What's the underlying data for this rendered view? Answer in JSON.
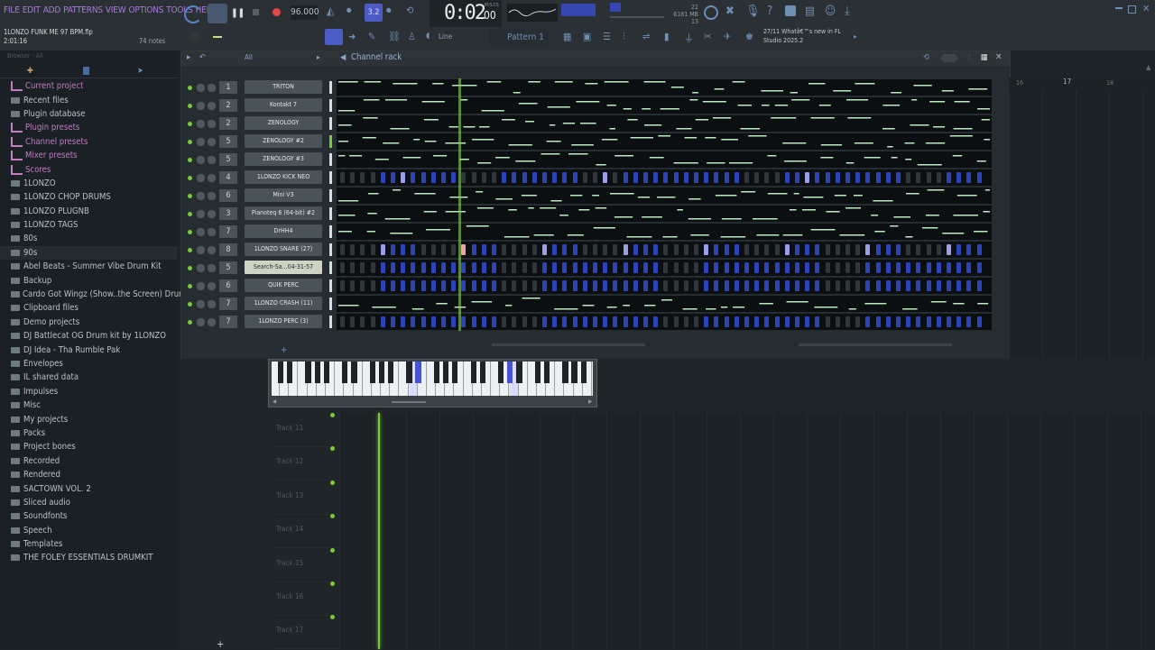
{
  "menu": [
    "FILE",
    "EDIT",
    "ADD",
    "PATTERNS",
    "VIEW",
    "OPTIONS",
    "TOOLS",
    "HELP"
  ],
  "project": {
    "file": "1LONZO FUNK ME 97 BPM.flp",
    "time": "2:01:16",
    "notes": "74 notes"
  },
  "transport": {
    "tempo": "96.000",
    "time": "0:02",
    "time_small": "00",
    "time_unit": "M:S:CS",
    "pattern": "Pattern 1",
    "line_mode": "Line",
    "cpu": "6181 MB",
    "cpu_sub": "13",
    "cpu_top": "22"
  },
  "news": {
    "date": "27/11",
    "text": "Whatâ€™s new in FL Studio 2025.2"
  },
  "browser": {
    "header": "Browser - All",
    "items": [
      {
        "label": "Current project",
        "type": "pink"
      },
      {
        "label": "Recent files",
        "type": "folder"
      },
      {
        "label": "Plugin database",
        "type": "folder"
      },
      {
        "label": "Plugin presets",
        "type": "pink"
      },
      {
        "label": "Channel presets",
        "type": "pink"
      },
      {
        "label": "Mixer presets",
        "type": "pink"
      },
      {
        "label": "Scores",
        "type": "pink"
      },
      {
        "label": "1LONZO",
        "type": "folder"
      },
      {
        "label": "1LONZO CHOP DRUMS",
        "type": "folder"
      },
      {
        "label": "1LONZO PLUGNB",
        "type": "folder"
      },
      {
        "label": "1LONZO TAGS",
        "type": "folder"
      },
      {
        "label": "80s",
        "type": "folder"
      },
      {
        "label": "90s",
        "type": "folder"
      },
      {
        "label": "Abel Beats - Summer Vibe Drum Kit",
        "type": "folder"
      },
      {
        "label": "Backup",
        "type": "folder"
      },
      {
        "label": "Cardo Got Wingz (Show..the Screen) Drumkit",
        "type": "folder"
      },
      {
        "label": "Clipboard files",
        "type": "folder"
      },
      {
        "label": "Demo projects",
        "type": "folder"
      },
      {
        "label": "DJ Battlecat OG Drum kit by 1LONZO",
        "type": "folder"
      },
      {
        "label": "DJ Idea - Tha Rumble Pak",
        "type": "folder"
      },
      {
        "label": "Envelopes",
        "type": "folder"
      },
      {
        "label": "IL shared data",
        "type": "folder"
      },
      {
        "label": "Impulses",
        "type": "folder"
      },
      {
        "label": "Misc",
        "type": "folder"
      },
      {
        "label": "My projects",
        "type": "folder"
      },
      {
        "label": "Packs",
        "type": "folder"
      },
      {
        "label": "Project bones",
        "type": "folder"
      },
      {
        "label": "Recorded",
        "type": "folder"
      },
      {
        "label": "Rendered",
        "type": "folder"
      },
      {
        "label": "SACTOWN VOL. 2",
        "type": "folder"
      },
      {
        "label": "Sliced audio",
        "type": "folder"
      },
      {
        "label": "Soundfonts",
        "type": "folder"
      },
      {
        "label": "Speech",
        "type": "folder"
      },
      {
        "label": "Templates",
        "type": "folder"
      },
      {
        "label": "THE FOLEY ESSENTIALS DRUMKIT",
        "type": "folder"
      }
    ]
  },
  "rack": {
    "title": "Channel rack",
    "filter": "All",
    "channels": [
      {
        "num": "1",
        "name": "TRITON",
        "lane": "notes"
      },
      {
        "num": "2",
        "name": "Kontakt 7",
        "lane": "notes"
      },
      {
        "num": "2",
        "name": "ZENOLOGY",
        "lane": "notes"
      },
      {
        "num": "5",
        "name": "ZENOLOGY #2",
        "lane": "notes"
      },
      {
        "num": "5",
        "name": "ZENOLOGY #3",
        "lane": "notes"
      },
      {
        "num": "4",
        "name": "1LONZO KICK NEO",
        "lane": "steps"
      },
      {
        "num": "6",
        "name": "Mini V3",
        "lane": "notes"
      },
      {
        "num": "3",
        "name": "Pianoteq 6 (64-bit) #2",
        "lane": "notes"
      },
      {
        "num": "7",
        "name": "DrHH4",
        "lane": "notes"
      },
      {
        "num": "8",
        "name": "1LONZO SNARE (27)",
        "lane": "steps"
      },
      {
        "num": "5",
        "name": "Search-Sa...04-31-57",
        "lane": "steps",
        "highlight": true
      },
      {
        "num": "6",
        "name": "QUIK PERC",
        "lane": "steps"
      },
      {
        "num": "7",
        "name": "1LONZO CRASH (11)",
        "lane": "notes"
      },
      {
        "num": "7",
        "name": "1LONZO PERC (3)",
        "lane": "steps"
      }
    ]
  },
  "playlist": {
    "tracks": [
      "Track 11",
      "Track 12",
      "Track 13",
      "Track 14",
      "Track 15",
      "Track 16",
      "Track 17"
    ],
    "bars": [
      "16",
      "17",
      "18"
    ]
  },
  "colors": {
    "accent": "#7ec83c",
    "step_on": "#2b45b8",
    "step_hi": "#9a9ee6",
    "note": "#bfe8c4"
  }
}
